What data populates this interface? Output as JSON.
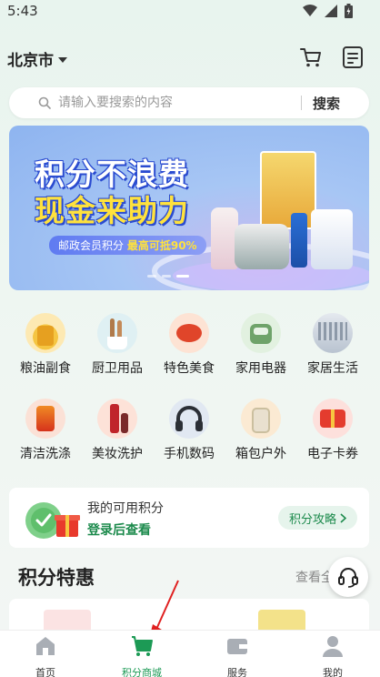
{
  "status_bar": {
    "time": "5:43"
  },
  "header": {
    "city": "北京市"
  },
  "search": {
    "placeholder": "请输入要搜索的内容",
    "button_label": "搜索"
  },
  "banner": {
    "title_line1": "积分不浪费",
    "title_line2": "现金来助力",
    "subtitle_prefix": "邮政会员积分",
    "subtitle_highlight": "最高可抵90%",
    "slide_count": 3,
    "active_slide": 3
  },
  "categories": [
    {
      "label": "粮油副食",
      "icon": "grain-oil-icon"
    },
    {
      "label": "厨卫用品",
      "icon": "kitchen-icon"
    },
    {
      "label": "特色美食",
      "icon": "food-icon"
    },
    {
      "label": "家用电器",
      "icon": "appliance-icon"
    },
    {
      "label": "家居生活",
      "icon": "home-living-icon"
    },
    {
      "label": "清洁洗涤",
      "icon": "cleaning-icon"
    },
    {
      "label": "美妆洗护",
      "icon": "beauty-icon"
    },
    {
      "label": "手机数码",
      "icon": "headphones-icon"
    },
    {
      "label": "箱包户外",
      "icon": "luggage-icon"
    },
    {
      "label": "电子卡券",
      "icon": "gift-card-icon"
    }
  ],
  "points": {
    "title": "我的可用积分",
    "login_text": "登录后查看",
    "guide_button": "积分攻略"
  },
  "section": {
    "title": "积分特惠",
    "more": "查看全"
  },
  "tabs": [
    {
      "label": "首页",
      "icon": "home-icon"
    },
    {
      "label": "积分商城",
      "icon": "shopping-cart-icon",
      "active": true
    },
    {
      "label": "服务",
      "icon": "wallet-icon"
    },
    {
      "label": "我的",
      "icon": "profile-icon"
    }
  ],
  "colors": {
    "accent": "#1c9a55",
    "accent_text": "#1c8a4c",
    "banner_blue": "#2a4bd0",
    "banner_yellow": "#ffe23d"
  }
}
